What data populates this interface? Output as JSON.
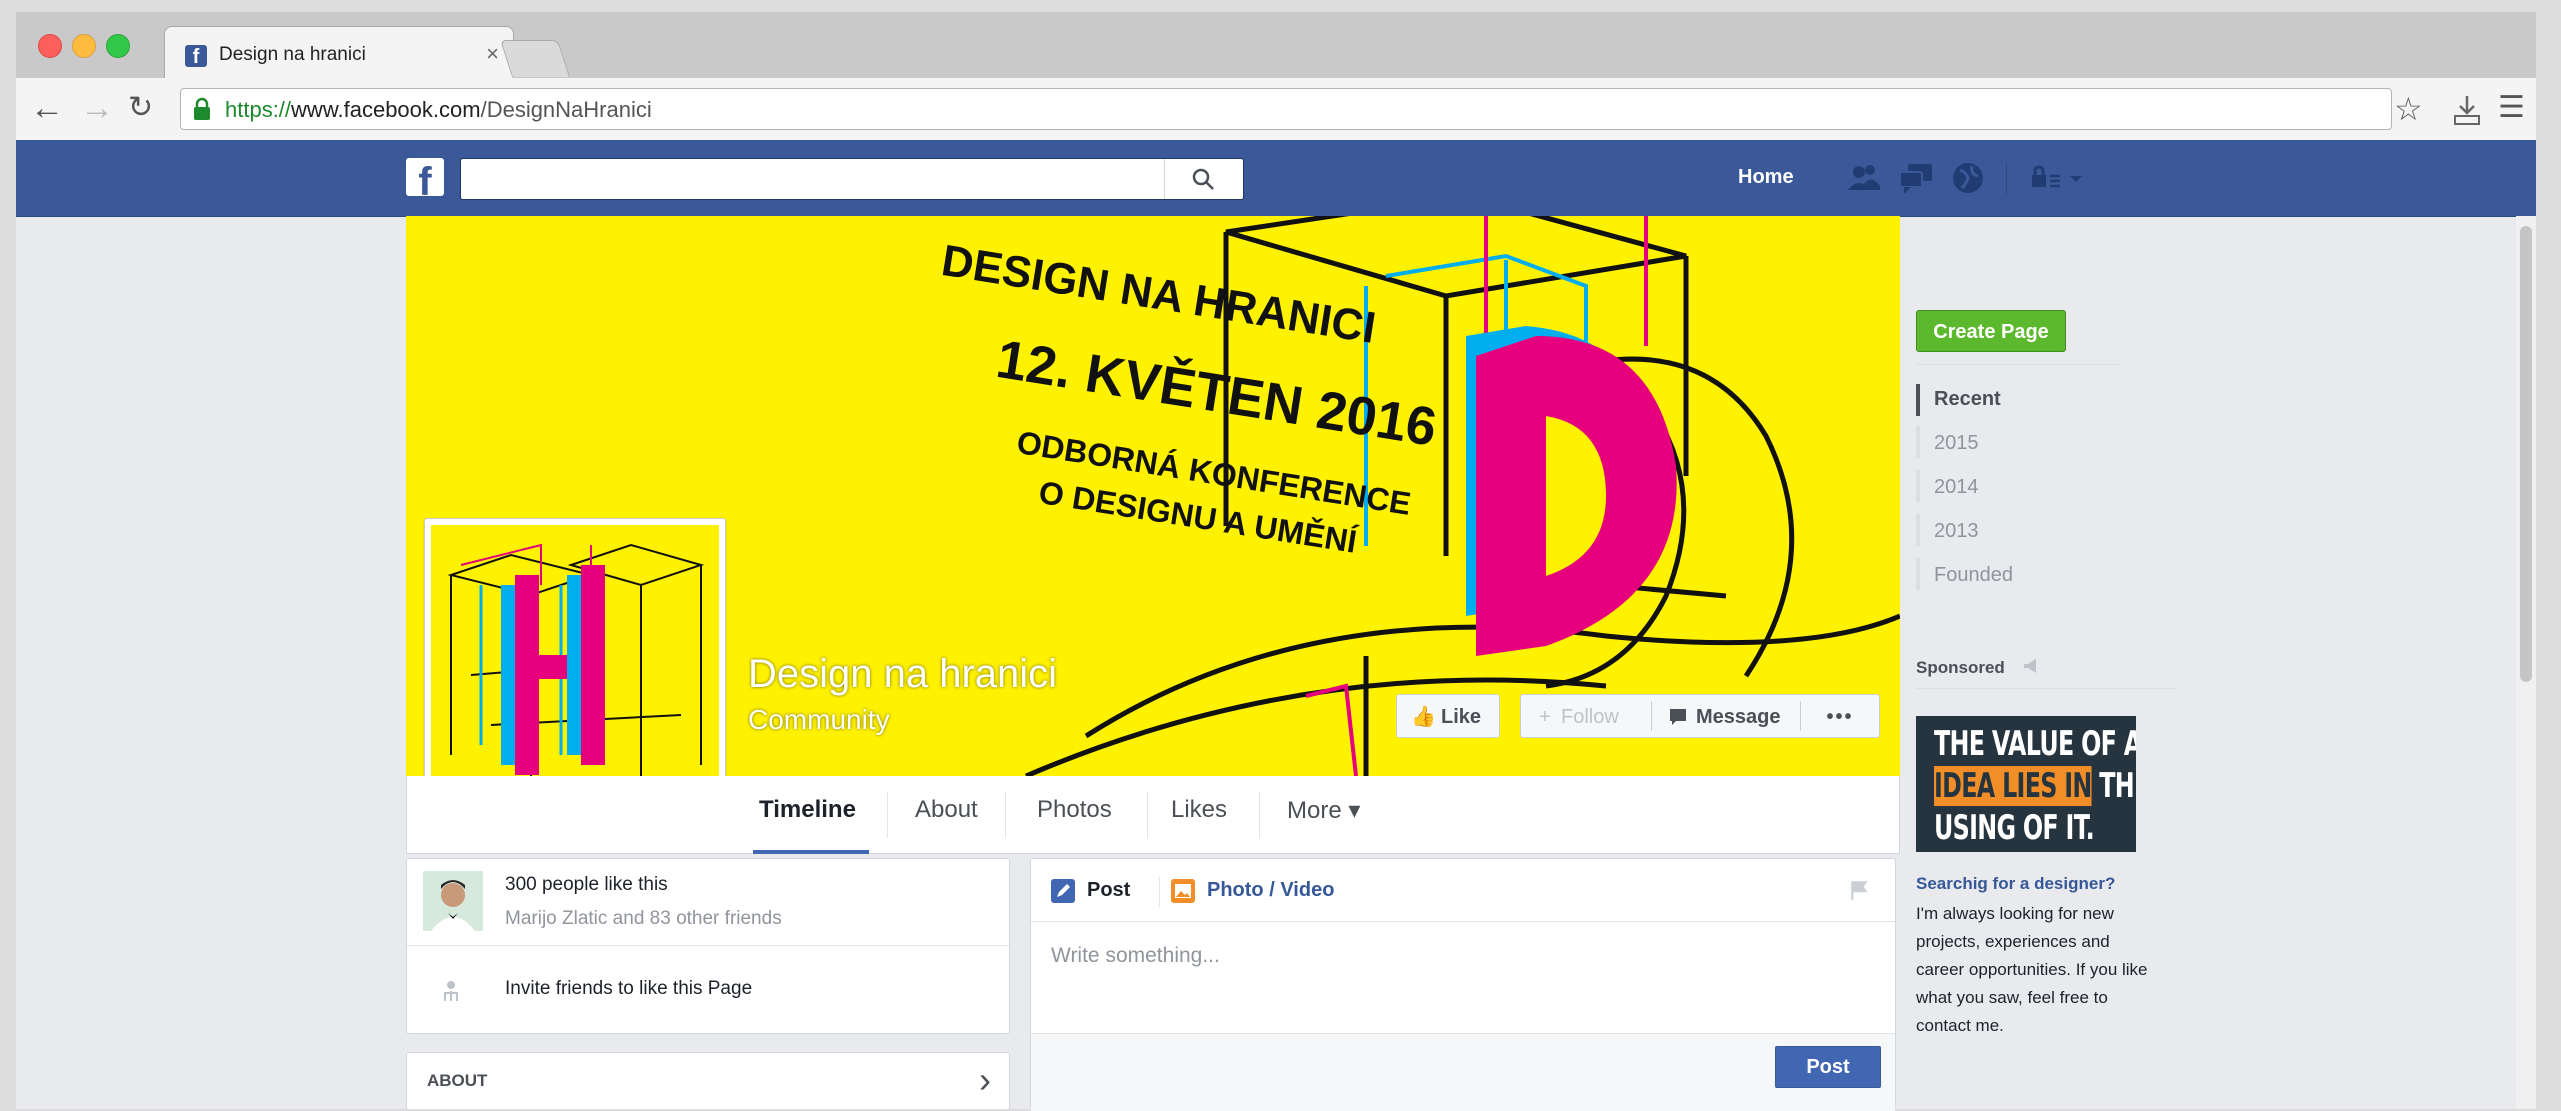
{
  "browser": {
    "tab_title": "Design na hranici",
    "tab_close": "×",
    "url_scheme": "https://",
    "url_domain": "www.facebook.com",
    "url_path": "/DesignNaHranici"
  },
  "fb": {
    "logo": "f",
    "search_placeholder": "",
    "home_label": "Home"
  },
  "cover": {
    "line1": "DESIGN NA HRANICI",
    "line2": "12. KVĚTEN 2016",
    "line3": "ODBORNÁ KONFERENCE",
    "line4": "O DESIGNU A UMĚNÍ",
    "big_letter": "D"
  },
  "page": {
    "name": "Design na hranici",
    "category": "Community",
    "like_label": "Like",
    "follow_label": "Follow",
    "message_label": "Message",
    "more_dots": "•••"
  },
  "tabs": [
    "Timeline",
    "About",
    "Photos",
    "Likes",
    "More ▾"
  ],
  "likes_card": {
    "count_text": "300 people like this",
    "friends_text": "Marijo Zlatic and 83 other friends",
    "invite_text": "Invite friends to like this Page"
  },
  "about_card": {
    "title": "ABOUT",
    "chevron": "›"
  },
  "composer": {
    "post_tab": "Post",
    "photo_tab": "Photo / Video",
    "placeholder": "Write something...",
    "post_button": "Post"
  },
  "sidebar": {
    "create_page": "Create Page",
    "years": [
      "Recent",
      "2015",
      "2014",
      "2013",
      "Founded"
    ],
    "sponsored": "Sponsored",
    "ad_line1": "THE VALUE OF AN",
    "ad_line2_hl": "IDEA LIES IN",
    "ad_line2_rest": " THE",
    "ad_line3": "USING OF IT.",
    "ad_title": "Searchig for a designer?",
    "ad_body": [
      "I'm always looking for new",
      "projects, experiences and",
      "career opportunities. If you like",
      "what you saw, feel free to",
      "contact me."
    ]
  },
  "colors": {
    "fb_blue": "#3b5998",
    "cover_yellow": "#fff200",
    "magenta": "#e6007e",
    "cyan": "#00aeef",
    "create_green": "#5cb82d",
    "ad_orange": "#f28e27"
  },
  "icons": [
    "lock-icon",
    "search-icon",
    "friends-icon",
    "messages-icon",
    "globe-icon",
    "privacy-icon",
    "like-icon",
    "message-icon",
    "pencil-icon",
    "photo-icon",
    "invite-icon",
    "flag-icon",
    "star-icon",
    "download-icon",
    "menu-icon"
  ]
}
